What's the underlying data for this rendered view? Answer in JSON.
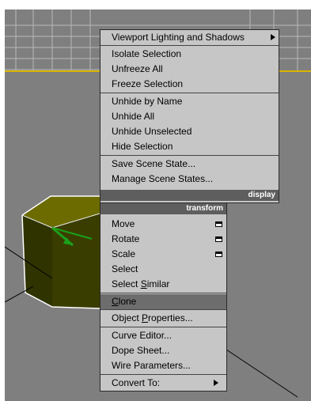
{
  "quad_menu": {
    "display_quadrant": {
      "header": "display",
      "groups": [
        [
          "Viewport Lighting and Shadows"
        ],
        [
          "Isolate Selection",
          "Unfreeze All",
          "Freeze Selection"
        ],
        [
          "Unhide by Name",
          "Unhide All",
          "Unhide Unselected",
          "Hide Selection"
        ],
        [
          "Save Scene State...",
          "Manage Scene States..."
        ]
      ]
    },
    "transform_quadrant": {
      "header": "transform",
      "items": [
        {
          "label": "Move",
          "has_settings_box": true
        },
        {
          "label": "Rotate",
          "has_settings_box": true
        },
        {
          "label": "Scale",
          "has_settings_box": true
        },
        {
          "label": "Select"
        },
        {
          "label": "Select Similar",
          "underline_char": "S",
          "underline_index": 7
        },
        {
          "label": "Clone",
          "underline_char": "C",
          "underline_index": 0,
          "highlighted": true
        },
        {
          "label": "Object Properties...",
          "underline_char": "P",
          "underline_index": 7
        },
        {
          "label": "Curve Editor..."
        },
        {
          "label": "Dope Sheet..."
        },
        {
          "label": "Wire Parameters..."
        },
        {
          "label": "Convert To:",
          "has_submenu": true
        }
      ]
    }
  },
  "colors": {
    "viewport_bg": "#7f7f7f",
    "menu_bg": "#c6c6c6",
    "header_bg": "#5e5e5e",
    "highlight_bg": "#6d6d6d",
    "object_face": "#6b6b00",
    "object_side": "#2e3300",
    "gizmo_green": "#1aa01a"
  }
}
